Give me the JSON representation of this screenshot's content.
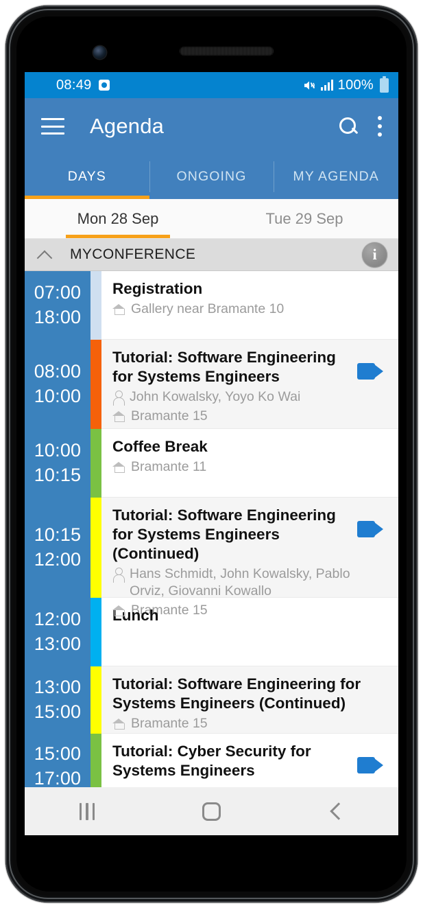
{
  "status_bar": {
    "clock": "08:49",
    "battery_percent": "100%",
    "icons": [
      "app-notification-icon",
      "mute-icon",
      "signal-bars-icon",
      "battery-icon"
    ],
    "background_color": "#0583cf"
  },
  "app_bar": {
    "title": "Agenda",
    "menu_icon": "hamburger-icon",
    "search_icon": "search-icon",
    "overflow_icon": "kebab-menu-icon",
    "background_color": "#4180bd"
  },
  "tabs": [
    {
      "label": "DAYS",
      "active": true
    },
    {
      "label": "ONGOING",
      "active": false
    },
    {
      "label": "MY AGENDA",
      "active": false
    }
  ],
  "accent_color": "#f7a11a",
  "dates": [
    {
      "label": "Mon 28 Sep",
      "active": true
    },
    {
      "label": "Tue 29 Sep",
      "active": false
    }
  ],
  "section": {
    "title": "MYCONFERENCE",
    "collapse_icon": "chevron-up-icon",
    "info_icon": "info-icon",
    "info_glyph": "i"
  },
  "events": [
    {
      "start": "07:00",
      "end": "18:00",
      "title": "Registration",
      "speakers": null,
      "location": "Gallery near Bramante 10",
      "strip_color": "#cfdff0",
      "has_video": false,
      "row_shade": "white"
    },
    {
      "start": "08:00",
      "end": "10:00",
      "title": "Tutorial: Software Engineering for Systems Engineers",
      "speakers": "John Kowalsky, Yoyo Ko Wai",
      "location": "Bramante 15",
      "strip_color": "#f5610a",
      "has_video": true,
      "row_shade": "alt"
    },
    {
      "start": "10:00",
      "end": "10:15",
      "title": "Coffee Break",
      "speakers": null,
      "location": "Bramante 11",
      "strip_color": "#7ac143",
      "has_video": false,
      "row_shade": "white"
    },
    {
      "start": "10:15",
      "end": "12:00",
      "title": "Tutorial: Software Engineering for Systems Engineers (Continued)",
      "speakers": "Hans Schmidt, John Kowalsky, Pablo Orviz, Giovanni Kowallo",
      "location": "Bramante 15",
      "strip_color": "#ffff00",
      "has_video": true,
      "row_shade": "alt"
    },
    {
      "start": "12:00",
      "end": "13:00",
      "title": "Lunch",
      "speakers": null,
      "location": null,
      "strip_color": "#00b0f0",
      "has_video": false,
      "row_shade": "white"
    },
    {
      "start": "13:00",
      "end": "15:00",
      "title": "Tutorial: Software Engineering for Systems Engineers (Continued)",
      "speakers": null,
      "location": "Bramante 15",
      "strip_color": "#ffff00",
      "has_video": false,
      "row_shade": "alt"
    },
    {
      "start": "15:00",
      "end": "17:00",
      "title": "Tutorial: Cyber Security for Systems Engineers",
      "speakers": null,
      "location": null,
      "strip_color": "#7ac143",
      "has_video": true,
      "row_shade": "white"
    }
  ],
  "nav_bar": {
    "recents_icon": "recents-icon",
    "home_icon": "home-button-icon",
    "back_icon": "back-icon"
  }
}
